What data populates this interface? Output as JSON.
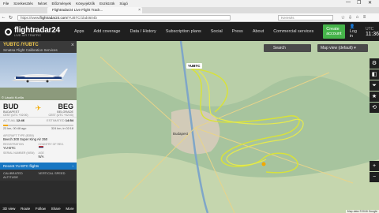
{
  "browser": {
    "menu": [
      "File",
      "Szerkesztés",
      "Nézet",
      "Előzmények",
      "Könyvjelzők",
      "Eszközök",
      "Súgó"
    ],
    "tab_title": "Flightradar24 Live Flight Track...",
    "url_prefix": "https://www.",
    "url_domain": "flightradar24.com",
    "url_path": "/YUBTC/1bd4604b",
    "search_placeholder": "Keresés",
    "min": "—",
    "max": "❐",
    "close": "✕"
  },
  "header": {
    "logo_text": "flightradar24",
    "logo_sub": "LIVE AIR TRAFFIC",
    "nav": [
      "Apps",
      "Add coverage",
      "Data / History",
      "Subscription plans",
      "Social",
      "Press",
      "About",
      "Commercial services"
    ],
    "create_account": "Create account",
    "login": "Log in",
    "utc_label": "UTC",
    "utc_time": "11:36"
  },
  "panel": {
    "callsign": "YUBTC /YUBTC",
    "airline": "Smatsa Flight Calibration Services",
    "photo_credit": "© László Kurilla",
    "origin": {
      "code": "BUD",
      "city": "BUDAPEST",
      "time": "CEST (UTC +02:00)"
    },
    "destination": {
      "code": "BEG",
      "city": "BELGRADE",
      "time": "CEST (UTC +02:00)"
    },
    "actual_label": "ACTUAL",
    "actual_time": "12:46",
    "estimated_label": "ESTIMATED",
    "estimated_time": "14:54",
    "progress": 0.07,
    "dist_left": "23 km, 00:48 ago",
    "dist_right": "324 km, in 02:18",
    "aircraft_type_label": "AIRCRAFT TYPE (B350)",
    "aircraft_type": "Beech 300 Super King Air 350",
    "registration_label": "REGISTRATION",
    "registration": "YU-BTC",
    "country_label": "COUNTRY OF REG.",
    "serial_label": "SERIAL NUMBER (MSN)",
    "serial": "",
    "age_label": "AGE",
    "age": "N/A",
    "recent": "Recent YU-BTC flights",
    "cal_alt_label": "CALIBRATED ALTITUDE",
    "vert_speed_label": "VERTICAL SPEED"
  },
  "bottom_bar": [
    "3D view",
    "Route",
    "Follow",
    "Share",
    "More"
  ],
  "map": {
    "search_label": "Search",
    "view_label": "Map view (default)",
    "aircraft_label": "YUBTC",
    "city_budapest": "Budapest",
    "footer": "Map data ©2018 Google"
  }
}
